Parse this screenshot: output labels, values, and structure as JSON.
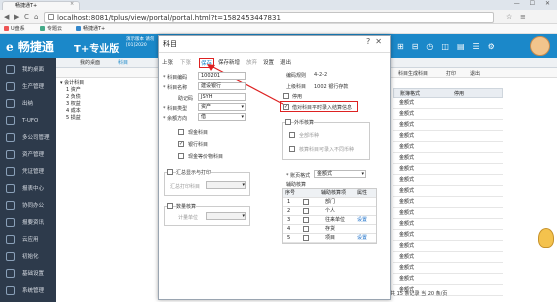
{
  "browser": {
    "tab_title": "畅捷通T+",
    "url": "localhost:8081/tplus/view/portal/portal.html?t=1582453447831",
    "bookmarks": [
      "U盘系",
      "专题云",
      "畅捷通T+"
    ],
    "win_controls": "— ☐ ✕"
  },
  "app": {
    "logo": "畅捷通",
    "edition": "T+专业版",
    "notice_line1": "演示版本 请勿",
    "notice_line2": "[01]2020",
    "colors": {
      "header": "#1b88c9",
      "sidebar": "#2d3a4b",
      "highlight": "#dd2222"
    }
  },
  "sidebar": {
    "items": [
      "我的桌面",
      "生产管理",
      "出纳",
      "T-UFO",
      "多公司管理",
      "资产管理",
      "凭证管理",
      "报表中心",
      "协同办公",
      "报要资讯",
      "云应用",
      "初始化",
      "基础设置",
      "系统管理"
    ]
  },
  "content": {
    "tabs": [
      "我的桌面",
      "科目"
    ],
    "tree_root": "会计科目",
    "tree_items": [
      "1 资产",
      "2 负债",
      "3 权益",
      "4 成本",
      "5 损益"
    ],
    "toolbar": [
      "科目生成科目",
      "打印",
      "退出"
    ],
    "table_headers": [
      "账簿格式",
      "停用"
    ],
    "table_rows": [
      "金额式",
      "金额式",
      "金额式",
      "金额式",
      "金额式",
      "金额式",
      "金额式",
      "金额式",
      "金额式",
      "金额式",
      "金额式",
      "金额式",
      "金额式",
      "金额式",
      "金额式",
      "金额式",
      "金额式",
      "金额式"
    ],
    "status": "共 15 条记录 当 20 条/页"
  },
  "dialog": {
    "title": "科目",
    "toolbar": [
      "上张",
      "下张",
      "保存",
      "保存新增",
      "放弃",
      "设置",
      "退出"
    ],
    "code_label": "* 科目编码",
    "code_value": "100201",
    "name_label": "* 科目名称",
    "name_value": "建设银行",
    "mnemonic_label": "助记码",
    "mnemonic_value": "JSYH",
    "type_label": "* 科目类型",
    "type_value": "资产",
    "direction_label": "* 余额方向",
    "direction_value": "借",
    "rule_label": "编码规则",
    "rule_value": "4-2-2",
    "parent_label": "上级科目",
    "parent_value": "1002 银行存款",
    "disable_label": "停用",
    "check_label": "借对科目平时录入结算信息",
    "checkboxes": [
      "现金科目",
      "银行科目",
      "现金等价物科目"
    ],
    "summary_group": "汇总显示与打印",
    "summary_field": "汇总打印科目",
    "qty_group": "数量核算",
    "qty_field": "计量单位",
    "currency_group": "外币核算",
    "currency_opt1": "全部币种",
    "currency_opt2": "核算科目可录入不同币种",
    "book_label": "* 账页格式",
    "book_value": "金额式",
    "aux_title": "辅助核算",
    "aux_headers": [
      "序号",
      "",
      "辅助核算项",
      "属性"
    ],
    "aux_rows": [
      {
        "n": "1",
        "name": "部门",
        "attr": ""
      },
      {
        "n": "2",
        "name": "个人",
        "attr": ""
      },
      {
        "n": "3",
        "name": "往来单位",
        "attr": "设置"
      },
      {
        "n": "4",
        "name": "存货",
        "attr": ""
      },
      {
        "n": "5",
        "name": "项目",
        "attr": "设置"
      }
    ]
  }
}
